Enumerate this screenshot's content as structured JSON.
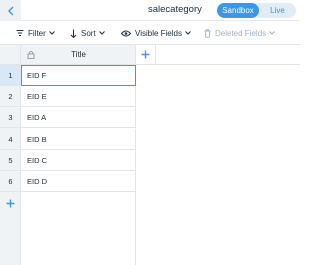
{
  "header": {
    "title": "salecategory",
    "env_toggle": {
      "active": "Sandbox",
      "inactive": "Live"
    },
    "accent": "#3899ec"
  },
  "toolbar": {
    "filter_label": "Filter",
    "sort_label": "Sort",
    "visible_fields_label": "Visible Fields",
    "deleted_fields_label": "Deleted Fields"
  },
  "table": {
    "columns": [
      {
        "label": "Title",
        "locked": true
      }
    ],
    "rows": [
      {
        "num": "1",
        "title": "EID F",
        "selected": true
      },
      {
        "num": "2",
        "title": "EID E"
      },
      {
        "num": "3",
        "title": "EID A"
      },
      {
        "num": "4",
        "title": "EID B"
      },
      {
        "num": "5",
        "title": "EID C"
      },
      {
        "num": "6",
        "title": "EID D"
      }
    ]
  },
  "icons": {
    "back": "chevron-left-icon",
    "filter": "filter-icon",
    "sort": "sort-arrows-icon",
    "visible": "eye-icon",
    "deleted": "trash-icon",
    "lock": "lock-icon",
    "add": "plus-icon"
  }
}
